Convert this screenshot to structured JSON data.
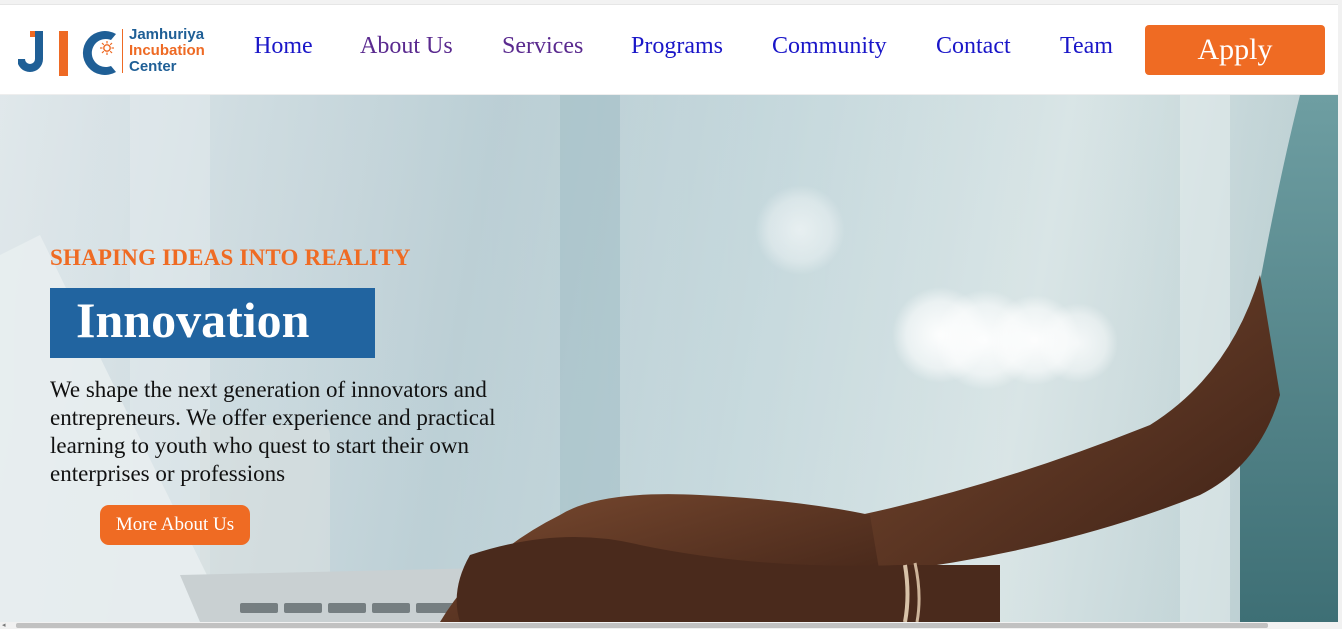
{
  "logo": {
    "line1": "Jamhuriya",
    "line2": "Incubation",
    "line3": "Center",
    "icon": "jic-logo-icon",
    "colors": {
      "blue": "#1f5f96",
      "orange": "#ee6a24"
    }
  },
  "nav": {
    "items": [
      {
        "label": "Home"
      },
      {
        "label": "About Us"
      },
      {
        "label": "Services"
      },
      {
        "label": "Programs"
      },
      {
        "label": "Community"
      },
      {
        "label": "Contact"
      },
      {
        "label": "Team"
      }
    ],
    "apply_label": "Apply",
    "link_color": "#1a16c8",
    "visited_color": "#5a2a8f"
  },
  "hero": {
    "kicker": "SHAPING IDEAS INTO REALITY",
    "title": "Innovation",
    "description": "We shape the next generation of innovators and entrepreneurs. We offer experience and practical learning to youth who quest to start their own enterprises or professions",
    "button_label": "More About Us",
    "accent_color": "#ef6b23",
    "title_bg_color": "#2164a0"
  }
}
